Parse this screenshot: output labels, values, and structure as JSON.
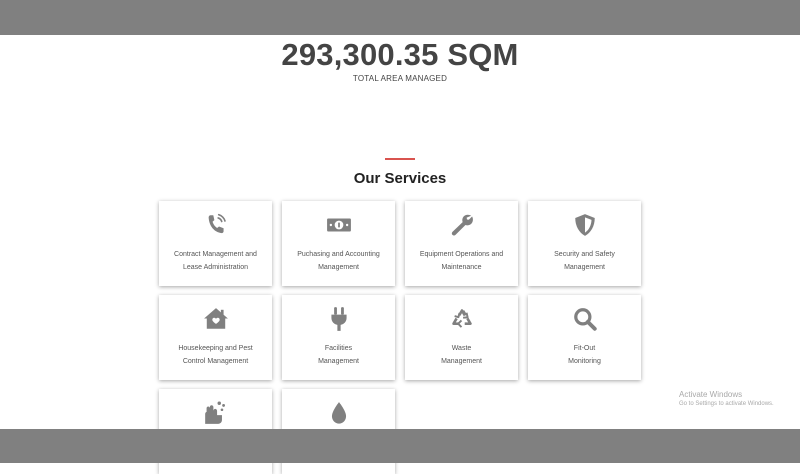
{
  "stat": {
    "value": "293,300.35 SQM",
    "label": "TOTAL AREA MANAGED"
  },
  "section": {
    "title": "Our Services"
  },
  "colors": {
    "accent": "#d9534f",
    "icon": "#808080",
    "bars": "#808080"
  },
  "services": [
    {
      "icon": "phone-icon",
      "label_1": "Contract Management and",
      "label_2": "Lease Administration"
    },
    {
      "icon": "money-icon",
      "label_1": "Puchasing and Accounting",
      "label_2": "Management"
    },
    {
      "icon": "wrench-icon",
      "label_1": "Equipment Operations and",
      "label_2": "Maintenance"
    },
    {
      "icon": "shield-icon",
      "label_1": "Security and Safety",
      "label_2": "Management"
    },
    {
      "icon": "house-icon",
      "label_1": "Housekeeping and Pest",
      "label_2": "Control Management"
    },
    {
      "icon": "plug-icon",
      "label_1": "Facilities",
      "label_2": "Management"
    },
    {
      "icon": "recycle-icon",
      "label_1": "Waste",
      "label_2": "Management"
    },
    {
      "icon": "search-icon",
      "label_1": "Fit-Out",
      "label_2": "Monitoring"
    },
    {
      "icon": "hands-wash-icon",
      "label_1": "",
      "label_2": ""
    },
    {
      "icon": "water-drop-icon",
      "label_1": "",
      "label_2": ""
    }
  ],
  "watermark": {
    "title": "Activate Windows",
    "subtitle": "Go to Settings to activate Windows."
  }
}
